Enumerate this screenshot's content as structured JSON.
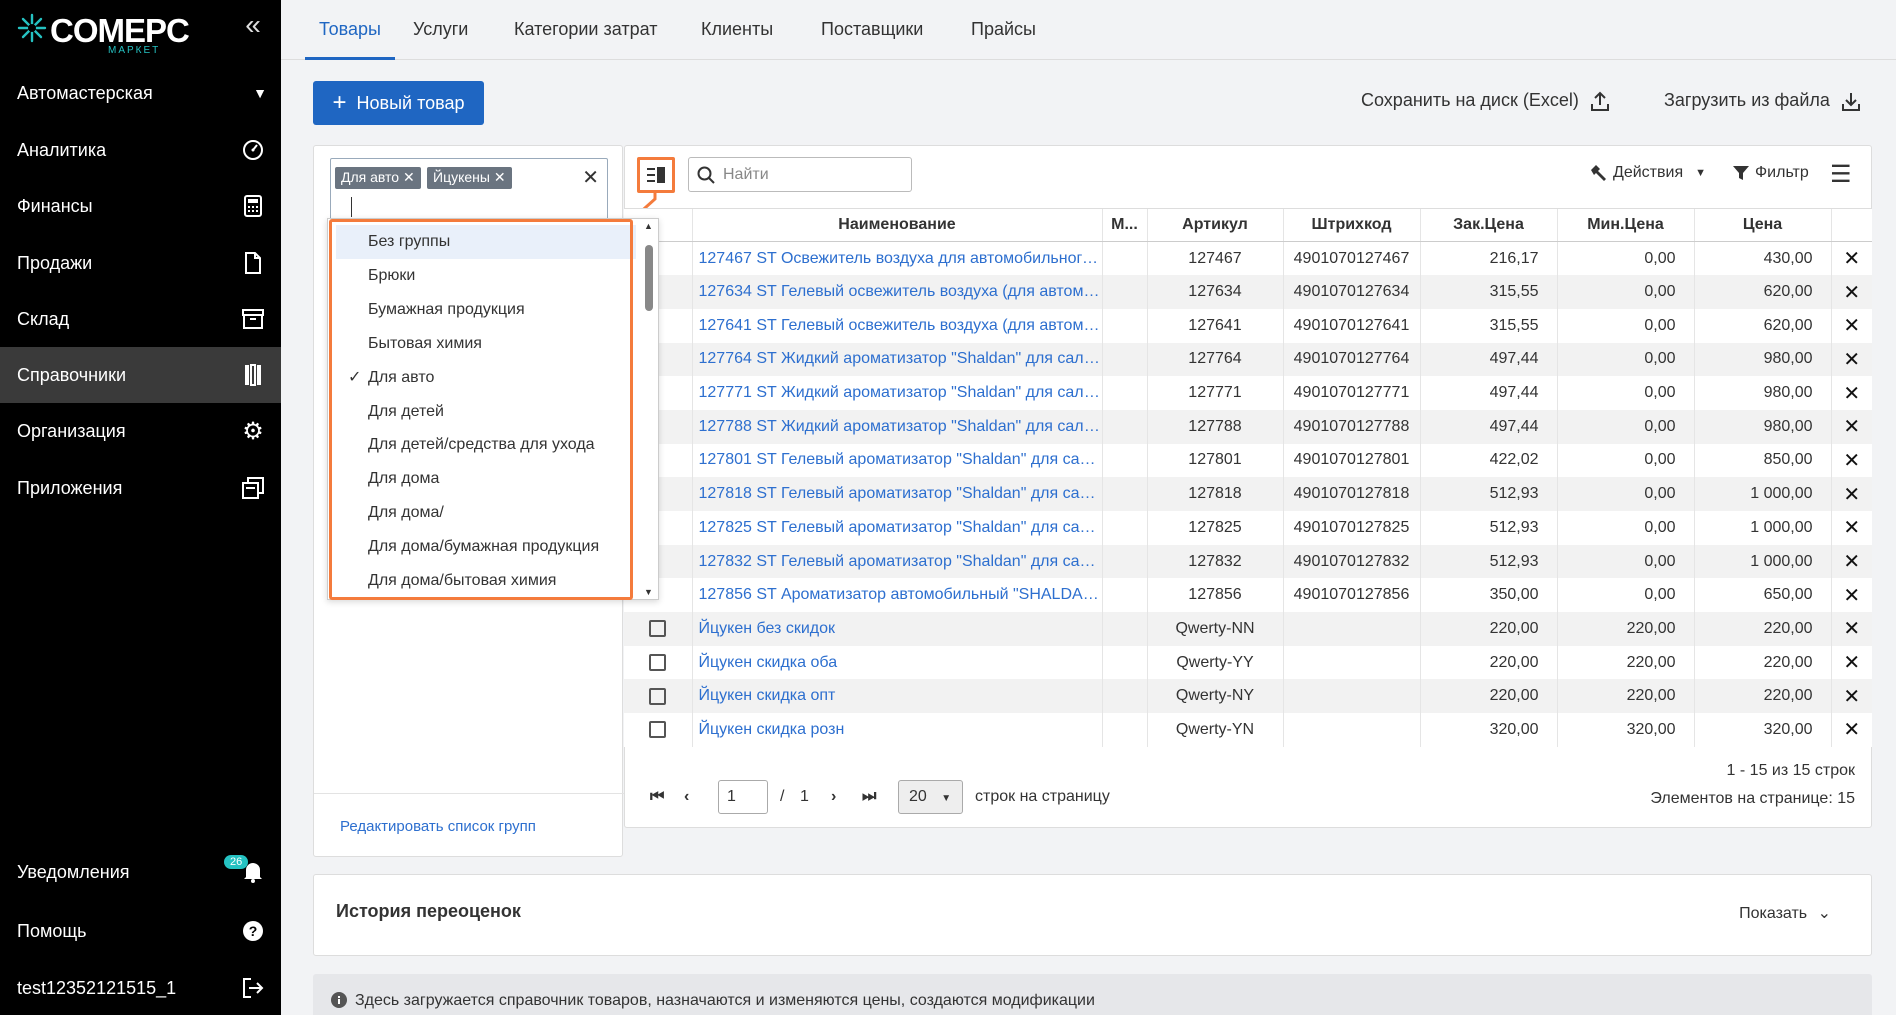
{
  "brand": {
    "name": "COMEPC",
    "sub": "МАРКЕТ"
  },
  "sidebar": {
    "org": "Автомастерская",
    "items": [
      {
        "label": "Аналитика"
      },
      {
        "label": "Финансы"
      },
      {
        "label": "Продажи"
      },
      {
        "label": "Склад"
      },
      {
        "label": "Справочники"
      },
      {
        "label": "Организация"
      },
      {
        "label": "Приложения"
      }
    ],
    "bottom": {
      "notifications": "Уведомления",
      "badge": "26",
      "help": "Помощь",
      "user": "test12352121515_1"
    }
  },
  "tabs": [
    "Товары",
    "Услуги",
    "Категории затрат",
    "Клиенты",
    "Поставщики",
    "Прайсы"
  ],
  "toolbar": {
    "new_button": "Новый товар",
    "save_excel": "Сохранить на диск (Excel)",
    "load_file": "Загрузить из файла"
  },
  "groups": {
    "tags": [
      "Для авто",
      "Йцукены"
    ],
    "dropdown": [
      {
        "label": "Без группы"
      },
      {
        "label": "Брюки"
      },
      {
        "label": "Бумажная продукция"
      },
      {
        "label": "Бытовая химия"
      },
      {
        "label": "Для авто"
      },
      {
        "label": "Для детей"
      },
      {
        "label": "Для детей/средства для ухода"
      },
      {
        "label": "Для дома"
      },
      {
        "label": "Для дома/"
      },
      {
        "label": "Для дома/бумажная продукция"
      },
      {
        "label": "Для дома/бытовая химия"
      }
    ],
    "edit_link": "Редактировать список групп"
  },
  "table_toolbar": {
    "search_placeholder": "Найти",
    "actions": "Действия",
    "filter": "Фильтр"
  },
  "table": {
    "headers": [
      "Наименование",
      "М...",
      "Артикул",
      "Штрихкод",
      "Зак.Цена",
      "Мин.Цена",
      "Цена"
    ],
    "rows": [
      {
        "name": "127467 ST Освежитель воздуха для автомобильного ...",
        "m": "",
        "article": "127467",
        "barcode": "4901070127467",
        "buy": "216,17",
        "min": "0,00",
        "price": "430,00"
      },
      {
        "name": "127634 ST Гелевый освежитель воздуха (для автомоб...",
        "m": "",
        "article": "127634",
        "barcode": "4901070127634",
        "buy": "315,55",
        "min": "0,00",
        "price": "620,00"
      },
      {
        "name": "127641 ST Гелевый освежитель воздуха (для автомоб...",
        "m": "",
        "article": "127641",
        "barcode": "4901070127641",
        "buy": "315,55",
        "min": "0,00",
        "price": "620,00"
      },
      {
        "name": "127764 ST Жидкий ароматизатор \"Shaldan\" для салон...",
        "m": "",
        "article": "127764",
        "barcode": "4901070127764",
        "buy": "497,44",
        "min": "0,00",
        "price": "980,00"
      },
      {
        "name": "127771 ST Жидкий ароматизатор \"Shaldan\" для салон...",
        "m": "",
        "article": "127771",
        "barcode": "4901070127771",
        "buy": "497,44",
        "min": "0,00",
        "price": "980,00"
      },
      {
        "name": "127788 ST Жидкий ароматизатор \"Shaldan\" для салон...",
        "m": "",
        "article": "127788",
        "barcode": "4901070127788",
        "buy": "497,44",
        "min": "0,00",
        "price": "980,00"
      },
      {
        "name": "127801 ST Гелевый ароматизатор \"Shaldan\" для сало...",
        "m": "",
        "article": "127801",
        "barcode": "4901070127801",
        "buy": "422,02",
        "min": "0,00",
        "price": "850,00"
      },
      {
        "name": "127818 ST Гелевый ароматизатор \"Shaldan\" для сало...",
        "m": "",
        "article": "127818",
        "barcode": "4901070127818",
        "buy": "512,93",
        "min": "0,00",
        "price": "1 000,00"
      },
      {
        "name": "127825 ST Гелевый ароматизатор \"Shaldan\" для сало...",
        "m": "",
        "article": "127825",
        "barcode": "4901070127825",
        "buy": "512,93",
        "min": "0,00",
        "price": "1 000,00"
      },
      {
        "name": "127832 ST Гелевый ароматизатор \"Shaldan\" для сало...",
        "m": "",
        "article": "127832",
        "barcode": "4901070127832",
        "buy": "512,93",
        "min": "0,00",
        "price": "1 000,00"
      },
      {
        "name": "127856 ST Ароматизатор автомобильный \"SHALDAN\"...",
        "m": "",
        "article": "127856",
        "barcode": "4901070127856",
        "buy": "350,00",
        "min": "0,00",
        "price": "650,00"
      },
      {
        "name": "Йцукен без скидок",
        "m": "",
        "article": "Qwerty-NN",
        "barcode": "",
        "buy": "220,00",
        "min": "220,00",
        "price": "220,00"
      },
      {
        "name": "Йцукен скидка оба",
        "m": "",
        "article": "Qwerty-YY",
        "barcode": "",
        "buy": "220,00",
        "min": "220,00",
        "price": "220,00"
      },
      {
        "name": "Йцукен скидка опт",
        "m": "",
        "article": "Qwerty-NY",
        "barcode": "",
        "buy": "220,00",
        "min": "220,00",
        "price": "220,00"
      },
      {
        "name": "Йцукен скидка розн",
        "m": "",
        "article": "Qwerty-YN",
        "barcode": "",
        "buy": "320,00",
        "min": "320,00",
        "price": "320,00"
      }
    ]
  },
  "pager": {
    "page": "1",
    "sep": "/",
    "total_pages": "1",
    "page_size": "20",
    "per_page_label": "строк на страницу",
    "range": "1 - 15 из 15 строк",
    "elements": "Элементов на странице: 15"
  },
  "history": {
    "title": "История переоценок",
    "show": "Показать"
  },
  "info": "Здесь загружается справочник товаров, назначаются и изменяются цены, создаются модификации",
  "colors": {
    "accent": "#1f66c2",
    "highlight": "#f47b3c",
    "teal": "#25c2c2",
    "link": "#2d6fcf"
  }
}
